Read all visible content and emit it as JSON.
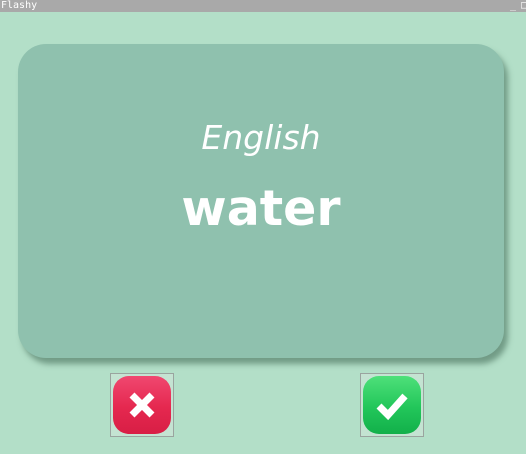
{
  "window": {
    "title": "Flashy",
    "minimize_glyph": "_",
    "maximize_glyph": "□"
  },
  "card": {
    "language": "English",
    "word": "water"
  },
  "buttons": {
    "wrong_icon": "close-icon",
    "right_icon": "check-icon"
  },
  "colors": {
    "background": "#b3dfc8",
    "card": "#8fc1ae",
    "wrong": "#e5284f",
    "right": "#22c65a"
  }
}
